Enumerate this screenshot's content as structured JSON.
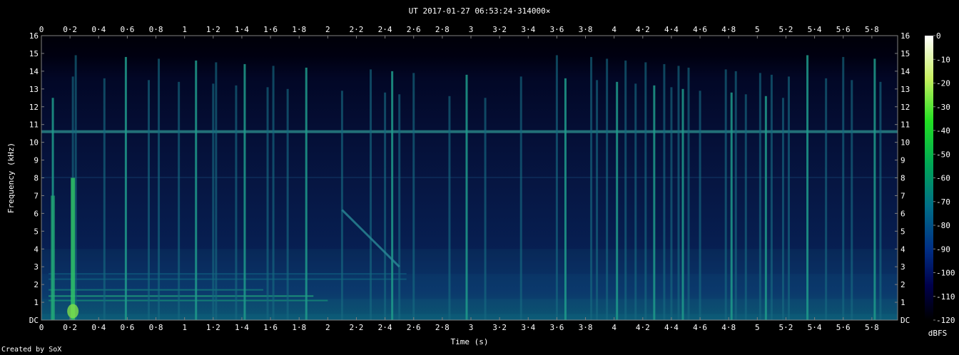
{
  "chart_data": {
    "type": "heatmap",
    "title": "UT 2017-01-27 06:53:24·314000×",
    "xlabel": "Time (s)",
    "ylabel": "Frequency (kHz)",
    "xlim": [
      0,
      5.98
    ],
    "ylim": [
      0,
      16
    ],
    "x_ticks": [
      "0",
      "0·2",
      "0·4",
      "0·6",
      "0·8",
      "1",
      "1·2",
      "1·4",
      "1·6",
      "1·8",
      "2",
      "2·2",
      "2·4",
      "2·6",
      "2·8",
      "3",
      "3·2",
      "3·4",
      "3·6",
      "3·8",
      "4",
      "4·2",
      "4·4",
      "4·6",
      "4·8",
      "5",
      "5·2",
      "5·4",
      "5·6",
      "5·8"
    ],
    "y_ticks": [
      "DC",
      "1",
      "2",
      "3",
      "4",
      "5",
      "6",
      "7",
      "8",
      "9",
      "10",
      "11",
      "12",
      "13",
      "14",
      "15",
      "16"
    ],
    "colorbar": {
      "label": "dBFS",
      "range": [
        -120,
        0
      ],
      "ticks": [
        "0",
        "-10",
        "-20",
        "-30",
        "-40",
        "-50",
        "-60",
        "-70",
        "-80",
        "-90",
        "-100",
        "-110",
        "-120"
      ]
    },
    "features": {
      "background_level_dBFS": -100,
      "tone_line_khz": 10.6,
      "impulses_s": [
        0.08,
        0.22,
        0.24,
        0.44,
        0.59,
        0.75,
        0.82,
        0.96,
        1.08,
        1.2,
        1.22,
        1.36,
        1.42,
        1.58,
        1.62,
        1.72,
        1.85,
        2.1,
        2.3,
        2.4,
        2.45,
        2.5,
        2.6,
        2.85,
        2.97,
        3.1,
        3.35,
        3.6,
        3.66,
        3.84,
        3.88,
        3.95,
        4.02,
        4.08,
        4.15,
        4.22,
        4.28,
        4.35,
        4.4,
        4.45,
        4.48,
        4.52,
        4.6,
        4.78,
        4.82,
        4.85,
        4.92,
        5.02,
        5.06,
        5.1,
        5.18,
        5.22,
        5.35,
        5.48,
        5.6,
        5.66,
        5.82,
        5.86
      ],
      "sweep": {
        "start_s": 2.1,
        "end_s": 2.5,
        "start_khz": 6.2,
        "end_khz": 3.0
      }
    }
  },
  "credit": "Created by SoX"
}
